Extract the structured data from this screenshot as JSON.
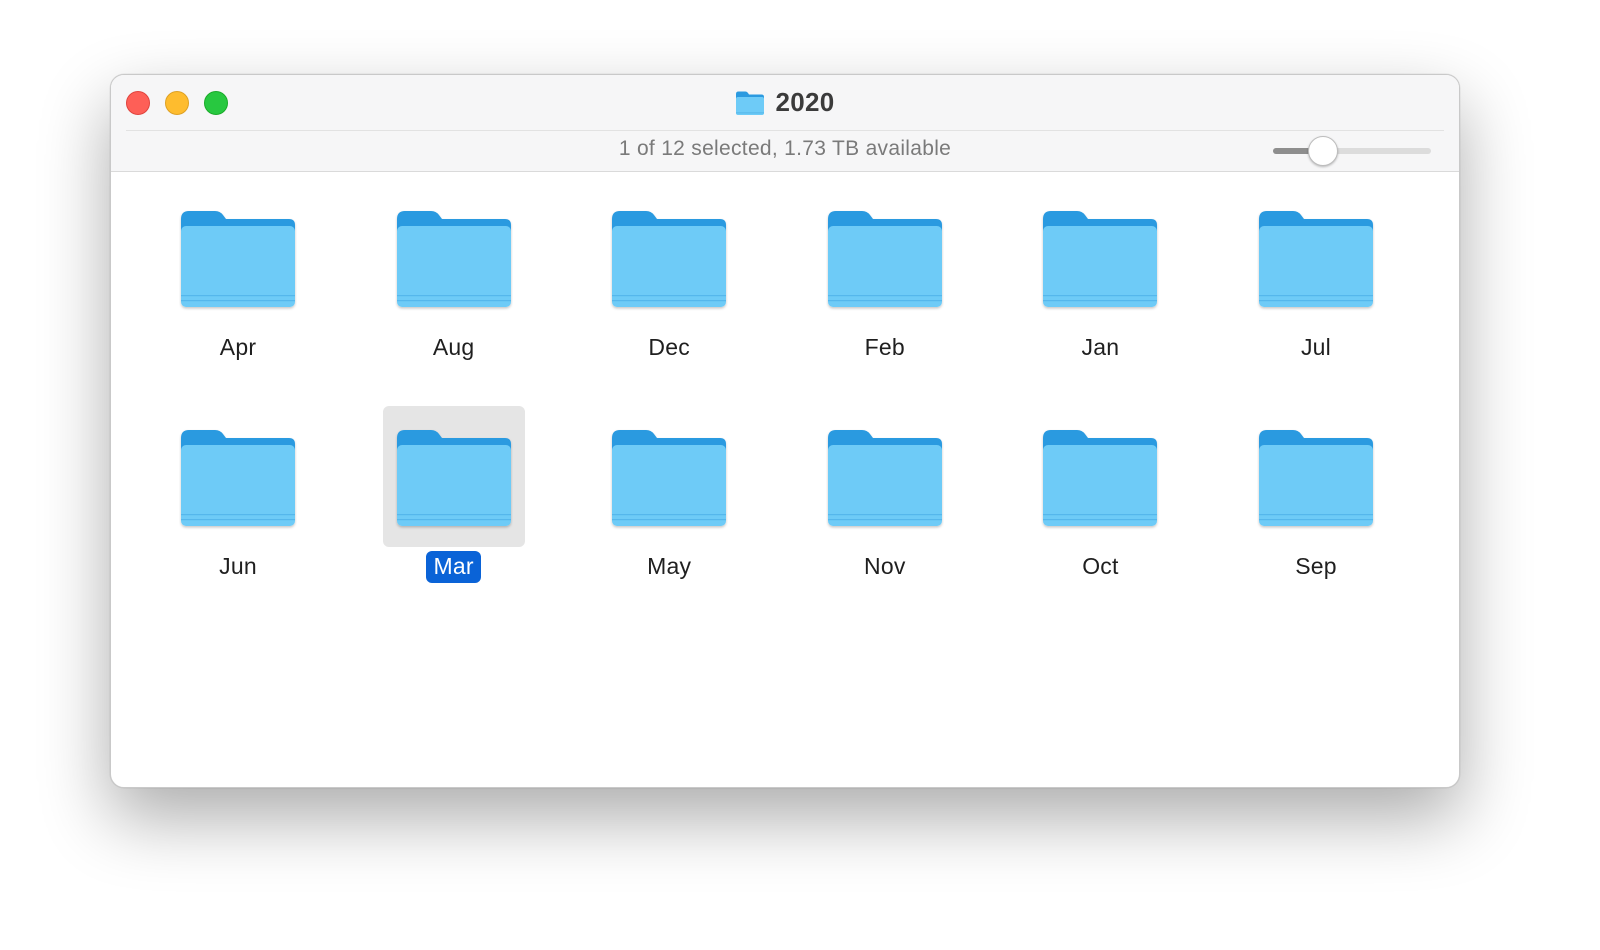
{
  "window": {
    "title": "2020",
    "title_icon": "folder-icon",
    "status": "1 of 12 selected, 1.73 TB available",
    "traffic_lights": [
      "close",
      "minimize",
      "zoom"
    ],
    "icon_size_slider": {
      "value": 0.27
    }
  },
  "folders": [
    {
      "name": "Apr",
      "selected": false
    },
    {
      "name": "Aug",
      "selected": false
    },
    {
      "name": "Dec",
      "selected": false
    },
    {
      "name": "Feb",
      "selected": false
    },
    {
      "name": "Jan",
      "selected": false
    },
    {
      "name": "Jul",
      "selected": false
    },
    {
      "name": "Jun",
      "selected": false
    },
    {
      "name": "Mar",
      "selected": true
    },
    {
      "name": "May",
      "selected": false
    },
    {
      "name": "Nov",
      "selected": false
    },
    {
      "name": "Oct",
      "selected": false
    },
    {
      "name": "Sep",
      "selected": false
    }
  ],
  "colors": {
    "folder_front": "#6ecbf7",
    "folder_back": "#2b9ae0",
    "selection_label": "#0a63d7",
    "selection_box": "#e5e5e5",
    "close": "#fe5f57",
    "minimize": "#febc2e",
    "zoom": "#28c840"
  }
}
